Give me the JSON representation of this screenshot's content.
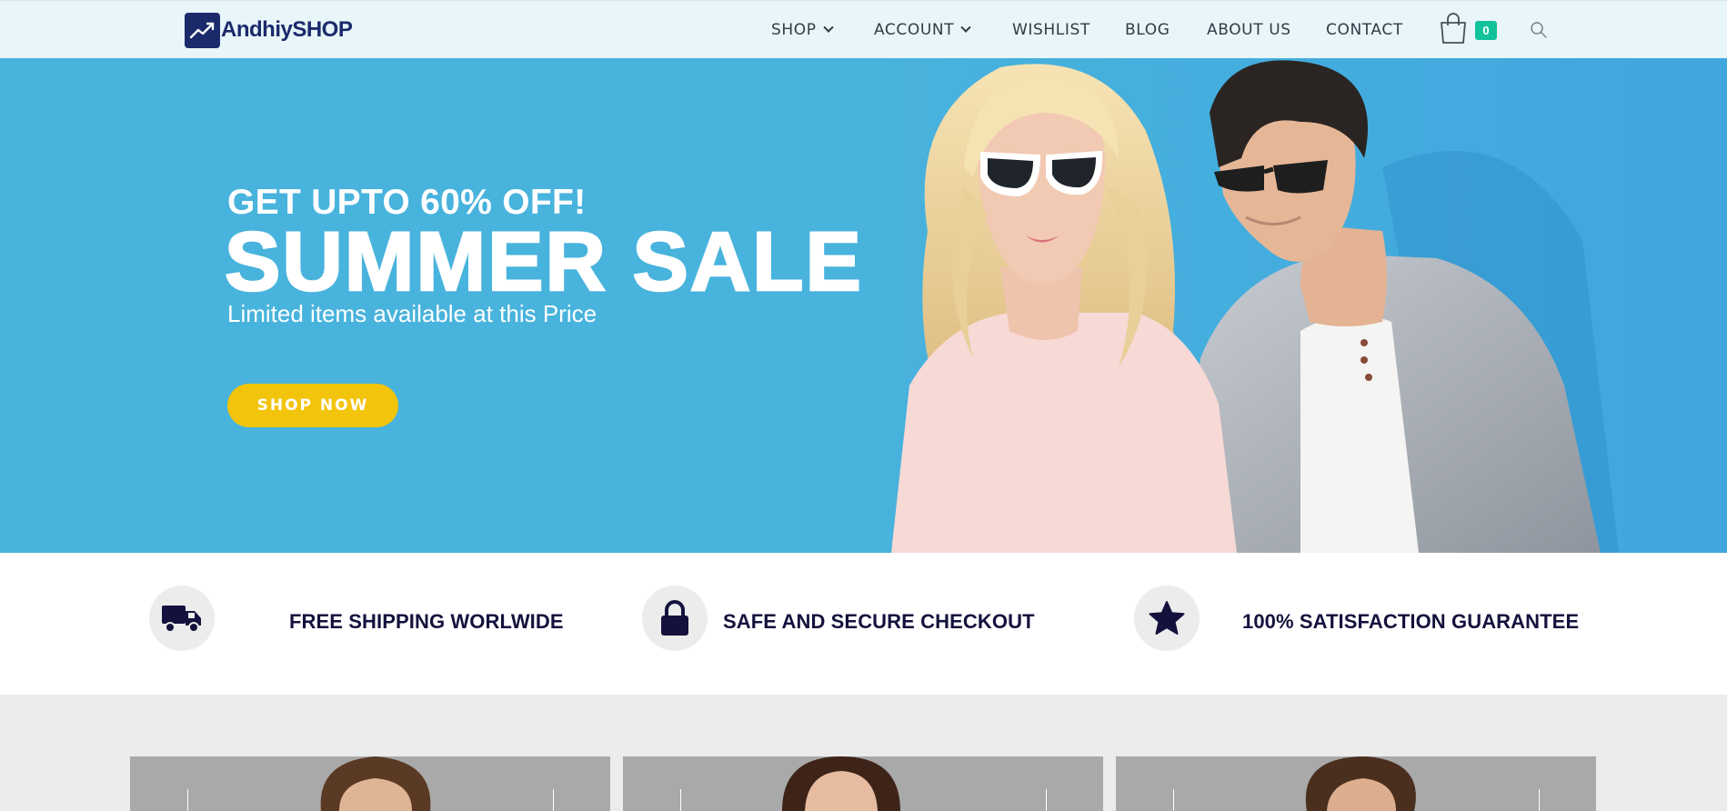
{
  "brand": {
    "name": "AndhiySHOP"
  },
  "nav": {
    "items": [
      {
        "label": "SHOP",
        "has_dropdown": true
      },
      {
        "label": "ACCOUNT",
        "has_dropdown": true
      },
      {
        "label": "WISHLIST",
        "has_dropdown": false
      },
      {
        "label": "BLOG",
        "has_dropdown": false
      },
      {
        "label": "ABOUT US",
        "has_dropdown": false
      },
      {
        "label": "CONTACT",
        "has_dropdown": false
      }
    ],
    "cart_icon": "shopping-bag-icon",
    "cart_count": "0",
    "search_icon": "search-icon"
  },
  "hero": {
    "kicker": "GET UPTO 60% OFF!",
    "title": "SUMMER SALE",
    "subtitle": "Limited items available at this Price",
    "cta_label": "SHOP NOW"
  },
  "features": [
    {
      "icon": "truck-icon",
      "label": "FREE SHIPPING WORLWIDE"
    },
    {
      "icon": "lock-icon",
      "label": "SAFE AND SECURE CHECKOUT"
    },
    {
      "icon": "star-icon",
      "label": "100% SATISFACTION GUARANTEE"
    }
  ],
  "colors": {
    "brand_navy": "#1b2a6b",
    "hero_blue": "#48b3dd",
    "cta_yellow": "#f2c40c",
    "badge_green": "#12c29a",
    "text_dark": "#14123d",
    "header_bg": "#e8f5f9"
  }
}
